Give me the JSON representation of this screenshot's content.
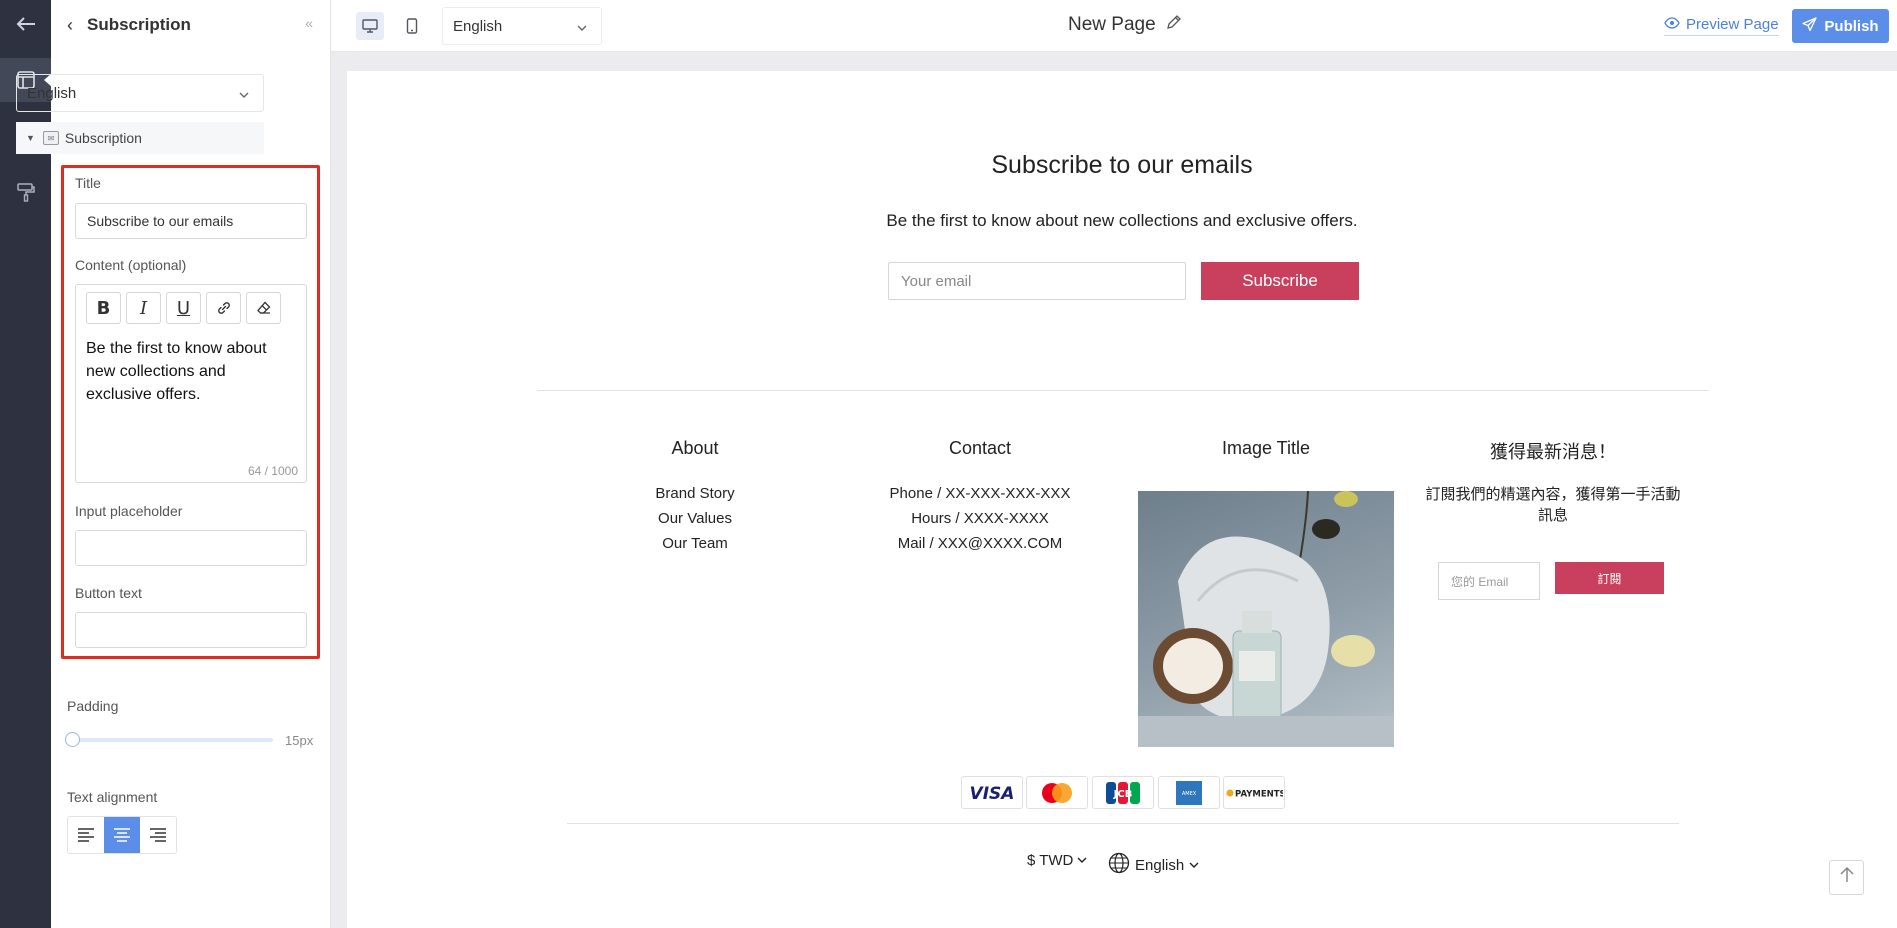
{
  "panel": {
    "title": "Subscription",
    "language": "English",
    "section": "Subscription",
    "fields": {
      "title_label": "Title",
      "title_value": "Subscribe to our emails",
      "content_label": "Content (optional)",
      "content_value": "Be the first to know about new collections and exclusive offers.",
      "content_counter": "64 / 1000",
      "placeholder_label": "Input placeholder",
      "placeholder_value": "",
      "button_label": "Button text",
      "button_value": ""
    },
    "padding_label": "Padding",
    "padding_value": "15px",
    "padding_level": 0.0,
    "align_label": "Text alignment",
    "align_selected": "center"
  },
  "topbar": {
    "language": "English",
    "page_name": "New Page",
    "preview": "Preview Page",
    "publish": "Publish"
  },
  "canvas": {
    "title": "Subscribe to our emails",
    "content": "Be the first to know about new collections and exclusive offers.",
    "email_placeholder": "Your email",
    "subscribe": "Subscribe",
    "footer": {
      "about": {
        "title": "About",
        "links": [
          "Brand Story",
          "Our Values",
          "Our Team"
        ]
      },
      "contact": {
        "title": "Contact",
        "links": [
          "Phone / XX-XXX-XXX-XXX",
          "Hours / XXXX-XXXX",
          "Mail / XXX@XXXX.COM"
        ]
      },
      "image_title": "Image Title",
      "news": {
        "title": "獲得最新消息！",
        "desc": "訂閱我們的精選內容，獲得第一手活動訊息",
        "email_placeholder": "您的 Email",
        "button": "訂閱"
      }
    },
    "payments": [
      "VISA",
      "Mastercard",
      "JCB",
      "American Express",
      "PAYMENTS"
    ],
    "currency": "$ TWD",
    "language": "English"
  },
  "colors": {
    "accent": "#5b8ee8",
    "brand": "#c8405e",
    "highlight": "#e02b20",
    "rail": "#2e3240"
  }
}
